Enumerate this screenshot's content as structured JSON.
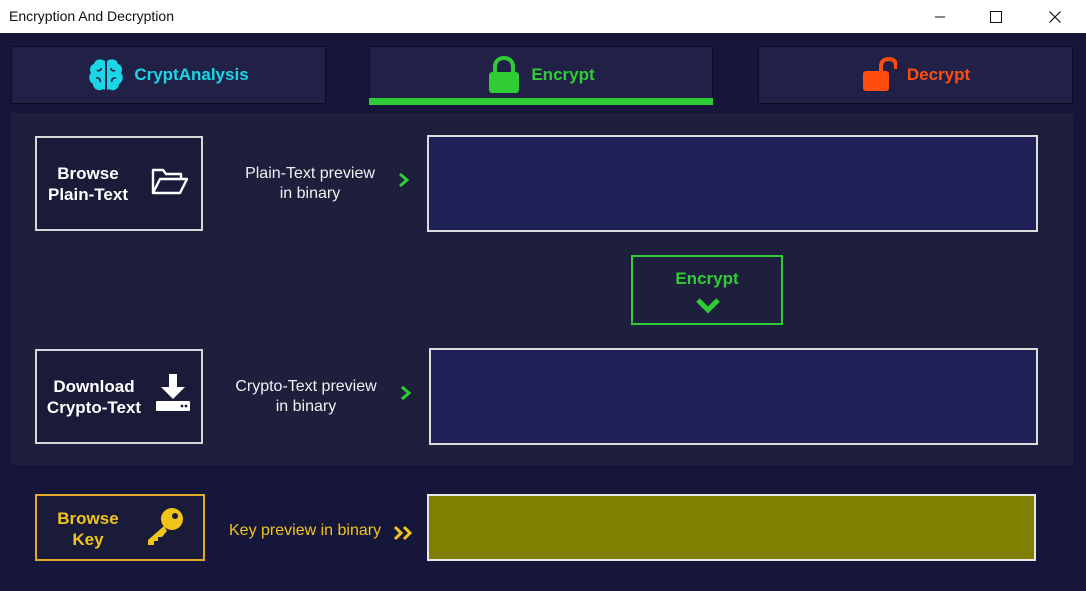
{
  "window": {
    "title": "Encryption And Decryption",
    "controls": [
      "minimize",
      "maximize",
      "close"
    ]
  },
  "tabs": [
    {
      "label": "CryptAnalysis",
      "icon": "brain-icon",
      "color": "#1ad6e6",
      "active": false
    },
    {
      "label": "Encrypt",
      "icon": "lock-icon",
      "color": "#2fcc35",
      "active": true
    },
    {
      "label": "Decrypt",
      "icon": "unlock-icon",
      "color": "#ff4d0d",
      "active": false
    }
  ],
  "plain": {
    "button_line1": "Browse",
    "button_line2": "Plain-Text",
    "button_icon": "folder-open-icon",
    "preview_line1": "Plain-Text preview",
    "preview_line2": "in binary"
  },
  "encrypt_action": {
    "label": "Encrypt",
    "icon": "chevron-down-icon"
  },
  "crypto": {
    "button_line1": "Download",
    "button_line2": "Crypto-Text",
    "button_icon": "download-icon",
    "preview_line1": "Crypto-Text preview",
    "preview_line2": "in binary"
  },
  "key": {
    "button_line1": "Browse",
    "button_line2": "Key",
    "button_icon": "key-icon",
    "preview_label": "Key preview in binary"
  },
  "colors": {
    "background": "#16163a",
    "panel": "#1e1e3d",
    "accent_green": "#2fcc35",
    "accent_yellow": "#f0c419",
    "accent_cyan": "#1ad6e6",
    "accent_red": "#ff4d0d",
    "preview_fill": "#202058",
    "key_fill": "#808000"
  }
}
